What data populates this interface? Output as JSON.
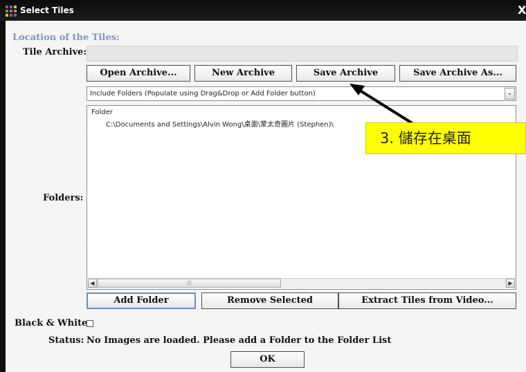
{
  "window": {
    "title": "Select Tiles",
    "close_glyph": "X"
  },
  "section_title": "Location of the Tiles:",
  "labels": {
    "tile_archive": "Tile Archive:",
    "folders": "Folders:",
    "black_white": "Black & White:",
    "status": "Status:"
  },
  "archive_field": {
    "value": ""
  },
  "archive_buttons": {
    "open": "Open Archive...",
    "new": "New Archive",
    "save": "Save Archive",
    "save_as": "Save Archive As..."
  },
  "folder_mode": {
    "selected": "Include Folders (Populate using Drag&Drop or Add Folder button)"
  },
  "folder_list": {
    "column_header": "Folder",
    "rows": [
      "C:\\Documents and Settings\\Alvin Wong\\桌面\\蒙太奇圖片 (Stephen)\\"
    ]
  },
  "folder_buttons": {
    "add": "Add Folder",
    "remove": "Remove Selected",
    "extract": "Extract Tiles from Video..."
  },
  "black_white": {
    "checked": false
  },
  "status_text": "No Images are loaded. Please add a Folder to the Folder List",
  "ok_label": "OK",
  "annotation": {
    "text": "3.  儲存在桌面"
  },
  "icons": [
    "app-icon",
    "close-icon",
    "chevron-down-icon",
    "chevron-left-icon",
    "chevron-right-icon",
    "scroll-grip-icon"
  ]
}
